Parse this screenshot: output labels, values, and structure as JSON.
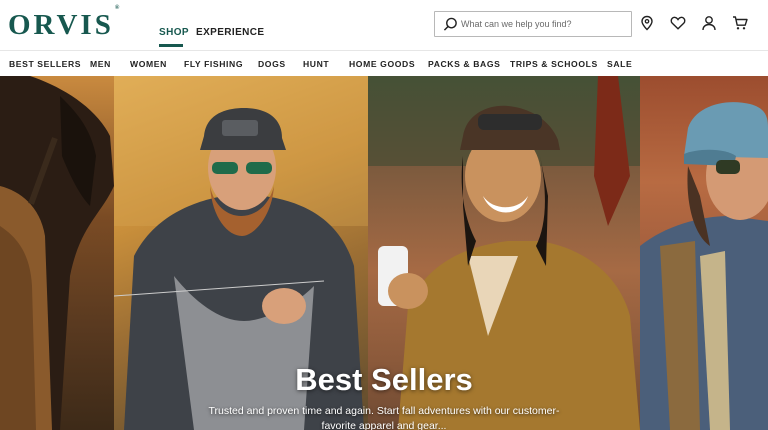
{
  "brand": {
    "logo_text": "ORVIS",
    "trademark": "®",
    "color": "#17584f"
  },
  "top_nav": {
    "shop": "SHOP",
    "experience": "EXPERIENCE"
  },
  "search": {
    "placeholder": "What can we help you find?",
    "value": ""
  },
  "header_icons": [
    "location-pin-icon",
    "heart-icon",
    "account-icon",
    "cart-icon"
  ],
  "nav": {
    "items": [
      "BEST SELLERS",
      "MEN",
      "WOMEN",
      "FLY FISHING",
      "DOGS",
      "HUNT",
      "HOME GOODS",
      "PACKS & BAGS",
      "TRIPS & SCHOOLS",
      "SALE"
    ]
  },
  "hero": {
    "title": "Best Sellers",
    "subtitle": "Trusted and proven time and again. Start fall adventures with our customer-favorite apparel and gear..."
  }
}
